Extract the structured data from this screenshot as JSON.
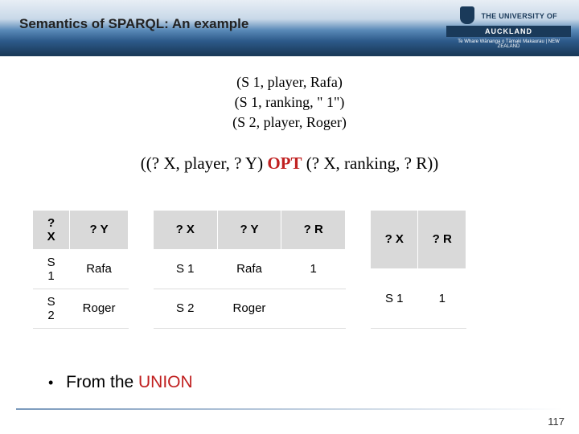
{
  "header": {
    "title": "Semantics of SPARQL: An example",
    "logo_text1": "THE UNIVERSITY OF",
    "logo_band": "AUCKLAND",
    "logo_text2": "Te Whare Wānanga o Tāmaki Makaurau | NEW ZEALAND"
  },
  "triples": [
    "(S 1, player, Rafa)",
    "(S 1, ranking, \" 1\")",
    "(S 2, player, Roger)"
  ],
  "query": {
    "left": "((? X, player, ? Y) ",
    "opt": "OPT",
    "right": " (? X, ranking, ? R))"
  },
  "table1": {
    "headers": [
      "? X",
      "? Y"
    ],
    "rows": [
      [
        "S 1",
        "Rafa"
      ],
      [
        "S 2",
        "Roger"
      ]
    ]
  },
  "table2": {
    "headers": [
      "? X",
      "? Y",
      "? R"
    ],
    "rows": [
      [
        "S 1",
        "Rafa",
        "1"
      ],
      [
        "S 2",
        "Roger",
        ""
      ]
    ]
  },
  "table3": {
    "headers": [
      "? X",
      "? R"
    ],
    "rows": [
      [
        "S 1",
        "1"
      ]
    ]
  },
  "bullet": {
    "prefix": "From the ",
    "union": "UNION"
  },
  "page": "117"
}
